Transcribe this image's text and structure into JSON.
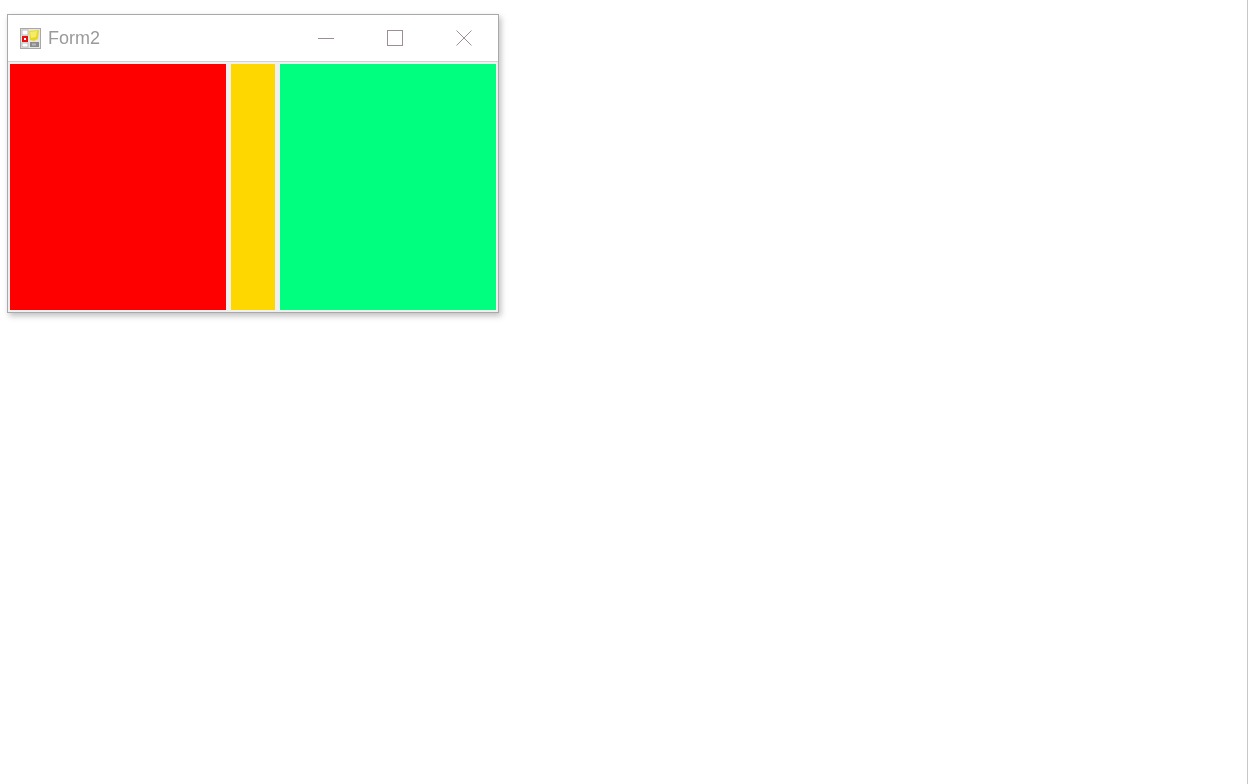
{
  "window": {
    "title": "Form2"
  },
  "panels": [
    {
      "color": "#ff0000"
    },
    {
      "color": "#ffd700"
    },
    {
      "color": "#00ff7f"
    }
  ]
}
